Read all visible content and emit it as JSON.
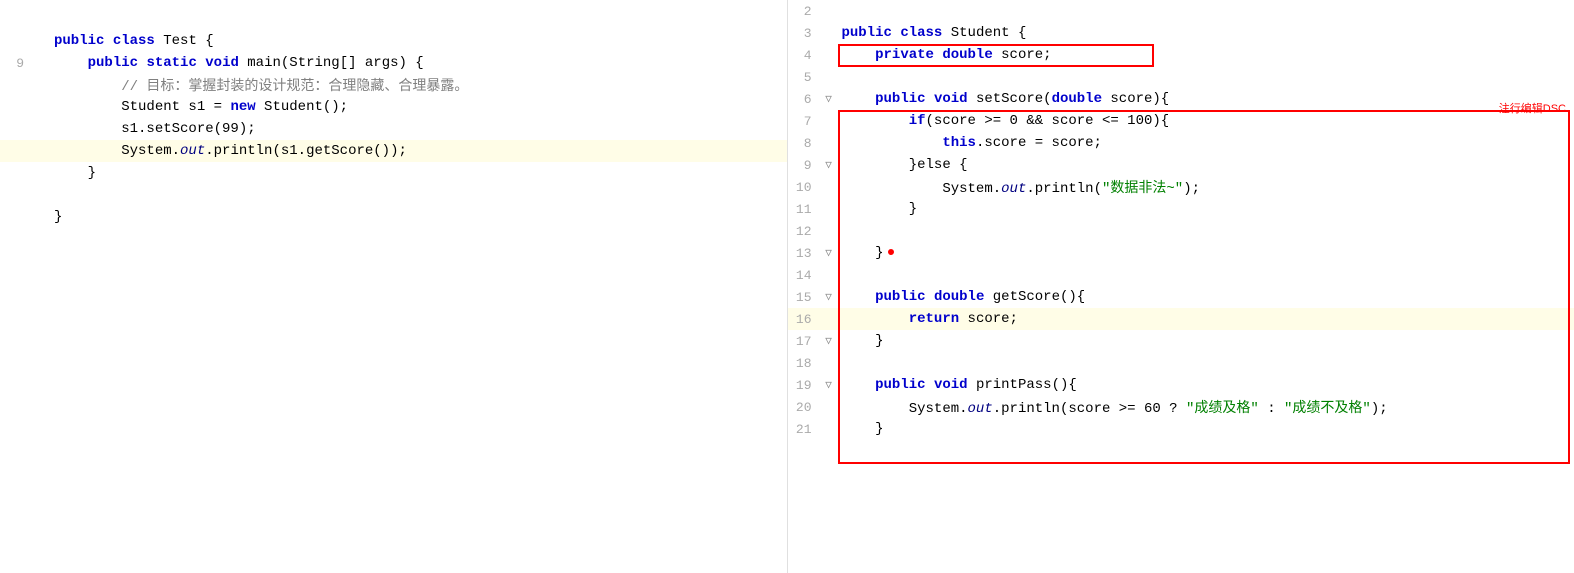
{
  "leftPane": {
    "lines": [
      {
        "num": "",
        "gutter": "",
        "content": "",
        "highlight": false,
        "parts": []
      },
      {
        "num": "",
        "gutter": "",
        "content": "public class Test {",
        "highlight": false,
        "parts": [
          {
            "text": "public ",
            "cls": "kw"
          },
          {
            "text": "class ",
            "cls": "kw"
          },
          {
            "text": "Test {",
            "cls": "normal"
          }
        ]
      },
      {
        "num": "9",
        "gutter": "",
        "content": "    public static void main(String[] args) {",
        "highlight": false,
        "parts": [
          {
            "text": "    ",
            "cls": "normal"
          },
          {
            "text": "public ",
            "cls": "kw"
          },
          {
            "text": "static ",
            "cls": "kw"
          },
          {
            "text": "void ",
            "cls": "kw"
          },
          {
            "text": "main(String[] args) {",
            "cls": "normal"
          }
        ]
      },
      {
        "num": "",
        "gutter": "",
        "content": "        // 目标：掌握封装的设计规范：合理隐藏、合理暴露。",
        "highlight": false,
        "parts": [
          {
            "text": "        // 目标：掌握封装的设计规范：合理隐藏、合理暴露。",
            "cls": "comment"
          }
        ]
      },
      {
        "num": "",
        "gutter": "",
        "content": "        Student s1 = new Student();",
        "highlight": false,
        "parts": [
          {
            "text": "        Student s1 = ",
            "cls": "normal"
          },
          {
            "text": "new ",
            "cls": "kw"
          },
          {
            "text": "Student();",
            "cls": "normal"
          }
        ]
      },
      {
        "num": "",
        "gutter": "",
        "content": "        s1.setScore(99);",
        "highlight": false,
        "parts": [
          {
            "text": "        s1.setScore(99);",
            "cls": "normal"
          }
        ]
      },
      {
        "num": "",
        "gutter": "highlight",
        "content": "        System.out.println(s1.getScore());",
        "highlight": true,
        "parts": [
          {
            "text": "        System.",
            "cls": "normal"
          },
          {
            "text": "out",
            "cls": "out-style"
          },
          {
            "text": ".println(s1.getScore());",
            "cls": "normal"
          }
        ]
      },
      {
        "num": "",
        "gutter": "",
        "content": "    }",
        "highlight": false,
        "parts": [
          {
            "text": "    }",
            "cls": "normal"
          }
        ]
      },
      {
        "num": "",
        "gutter": "",
        "content": "",
        "highlight": false,
        "parts": []
      },
      {
        "num": "",
        "gutter": "",
        "content": "}",
        "highlight": false,
        "parts": [
          {
            "text": "}",
            "cls": "normal"
          }
        ]
      }
    ]
  },
  "rightPane": {
    "lines": [
      {
        "num": "2",
        "gutter": "",
        "content": "",
        "highlight": false
      },
      {
        "num": "3",
        "gutter": "",
        "content": "public class Student {",
        "highlight": false,
        "parts": [
          {
            "text": "public ",
            "cls": "kw"
          },
          {
            "text": "class ",
            "cls": "kw"
          },
          {
            "text": "Student {",
            "cls": "normal"
          }
        ]
      },
      {
        "num": "4",
        "gutter": "",
        "content": "    private double score;",
        "highlight": false,
        "parts": [
          {
            "text": "    ",
            "cls": "normal"
          },
          {
            "text": "private ",
            "cls": "kw"
          },
          {
            "text": "double ",
            "cls": "kw"
          },
          {
            "text": "score;",
            "cls": "normal"
          }
        ]
      },
      {
        "num": "5",
        "gutter": "",
        "content": "",
        "highlight": false
      },
      {
        "num": "6",
        "gutter": "arrow",
        "content": "    public void setScore(double score){",
        "highlight": false,
        "parts": [
          {
            "text": "    ",
            "cls": "normal"
          },
          {
            "text": "public ",
            "cls": "kw"
          },
          {
            "text": "void ",
            "cls": "kw"
          },
          {
            "text": "setScore(",
            "cls": "normal"
          },
          {
            "text": "double ",
            "cls": "kw"
          },
          {
            "text": "score){",
            "cls": "normal"
          }
        ]
      },
      {
        "num": "7",
        "gutter": "",
        "content": "        if(score >= 0 && score <= 100){",
        "highlight": false,
        "parts": [
          {
            "text": "        ",
            "cls": "normal"
          },
          {
            "text": "if",
            "cls": "kw"
          },
          {
            "text": "(score >= 0 && score <= 100){",
            "cls": "normal"
          }
        ]
      },
      {
        "num": "8",
        "gutter": "",
        "content": "            this.score = score;",
        "highlight": false,
        "parts": [
          {
            "text": "            ",
            "cls": "normal"
          },
          {
            "text": "this",
            "cls": "kw"
          },
          {
            "text": ".score = score;",
            "cls": "normal"
          }
        ]
      },
      {
        "num": "9",
        "gutter": "arrow",
        "content": "        }else {",
        "highlight": false,
        "parts": [
          {
            "text": "        }else {",
            "cls": "normal"
          }
        ]
      },
      {
        "num": "10",
        "gutter": "",
        "content": "            System.out.println(\"数据非法~\");",
        "highlight": false,
        "parts": [
          {
            "text": "            System.",
            "cls": "normal"
          },
          {
            "text": "out",
            "cls": "out-style"
          },
          {
            "text": ".println(",
            "cls": "normal"
          },
          {
            "text": "\"数据非法~\"",
            "cls": "string"
          },
          {
            "text": ");",
            "cls": "normal"
          }
        ]
      },
      {
        "num": "11",
        "gutter": "",
        "content": "        }",
        "highlight": false,
        "parts": [
          {
            "text": "        }",
            "cls": "normal"
          }
        ]
      },
      {
        "num": "12",
        "gutter": "",
        "content": "",
        "highlight": false
      },
      {
        "num": "13",
        "gutter": "arrow",
        "content": "    }",
        "highlight": false,
        "hasDot": true,
        "parts": [
          {
            "text": "    }",
            "cls": "normal"
          }
        ]
      },
      {
        "num": "14",
        "gutter": "",
        "content": "",
        "highlight": false
      },
      {
        "num": "15",
        "gutter": "arrow",
        "content": "    public double getScore(){",
        "highlight": false,
        "parts": [
          {
            "text": "    ",
            "cls": "normal"
          },
          {
            "text": "public ",
            "cls": "kw"
          },
          {
            "text": "double ",
            "cls": "kw"
          },
          {
            "text": "getScore(){",
            "cls": "normal"
          }
        ]
      },
      {
        "num": "16",
        "gutter": "",
        "content": "        return score;",
        "highlight": true,
        "parts": [
          {
            "text": "        ",
            "cls": "normal"
          },
          {
            "text": "return ",
            "cls": "kw"
          },
          {
            "text": "score;",
            "cls": "normal"
          }
        ]
      },
      {
        "num": "17",
        "gutter": "arrow",
        "content": "    }",
        "highlight": false,
        "parts": [
          {
            "text": "    }",
            "cls": "normal"
          }
        ]
      },
      {
        "num": "18",
        "gutter": "",
        "content": "",
        "highlight": false
      },
      {
        "num": "19",
        "gutter": "arrow",
        "content": "    public void printPass(){",
        "highlight": false,
        "parts": [
          {
            "text": "    ",
            "cls": "normal"
          },
          {
            "text": "public ",
            "cls": "kw"
          },
          {
            "text": "void ",
            "cls": "kw"
          },
          {
            "text": "printPass(){",
            "cls": "normal"
          }
        ]
      },
      {
        "num": "20",
        "gutter": "",
        "content": "        System.out.println(score >= 60 ? \"成绩及格\" : \"成绩不及格\");",
        "highlight": false,
        "parts": [
          {
            "text": "        System.",
            "cls": "normal"
          },
          {
            "text": "out",
            "cls": "out-style"
          },
          {
            "text": ".println(score >= 60 ? ",
            "cls": "normal"
          },
          {
            "text": "\"成绩及格\"",
            "cls": "string"
          },
          {
            "text": " : ",
            "cls": "normal"
          },
          {
            "text": "\"成绩不及格\"",
            "cls": "string"
          },
          {
            "text": ");",
            "cls": "normal"
          }
        ]
      },
      {
        "num": "21",
        "gutter": "",
        "content": "    }",
        "highlight": false,
        "parts": [
          {
            "text": "    }",
            "cls": "normal"
          }
        ]
      }
    ]
  }
}
